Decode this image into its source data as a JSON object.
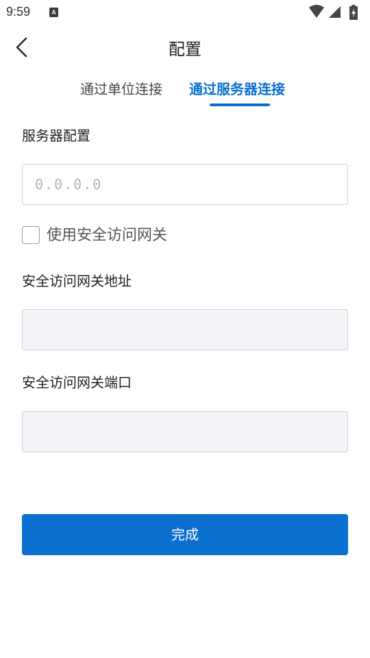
{
  "status_bar": {
    "time": "9:59",
    "notification_icon": "A",
    "icons": [
      "wifi-icon",
      "signal-icon",
      "battery-charging-icon"
    ]
  },
  "header": {
    "title": "配置",
    "back_icon": "chevron-left-icon"
  },
  "tabs": [
    {
      "label": "通过单位连接",
      "active": false
    },
    {
      "label": "通过服务器连接",
      "active": true
    }
  ],
  "form": {
    "server_config_label": "服务器配置",
    "server_placeholder": "0.0.0.0",
    "server_value": "",
    "use_gateway_label": "使用安全访问网关",
    "use_gateway_checked": false,
    "gateway_address_label": "安全访问网关地址",
    "gateway_address_value": "",
    "gateway_port_label": "安全访问网关端口",
    "gateway_port_value": ""
  },
  "done_button": "完成",
  "colors": {
    "accent": "#0a6fce",
    "disabled_input_bg": "#f4f5f8",
    "border": "#cfcfd4"
  }
}
